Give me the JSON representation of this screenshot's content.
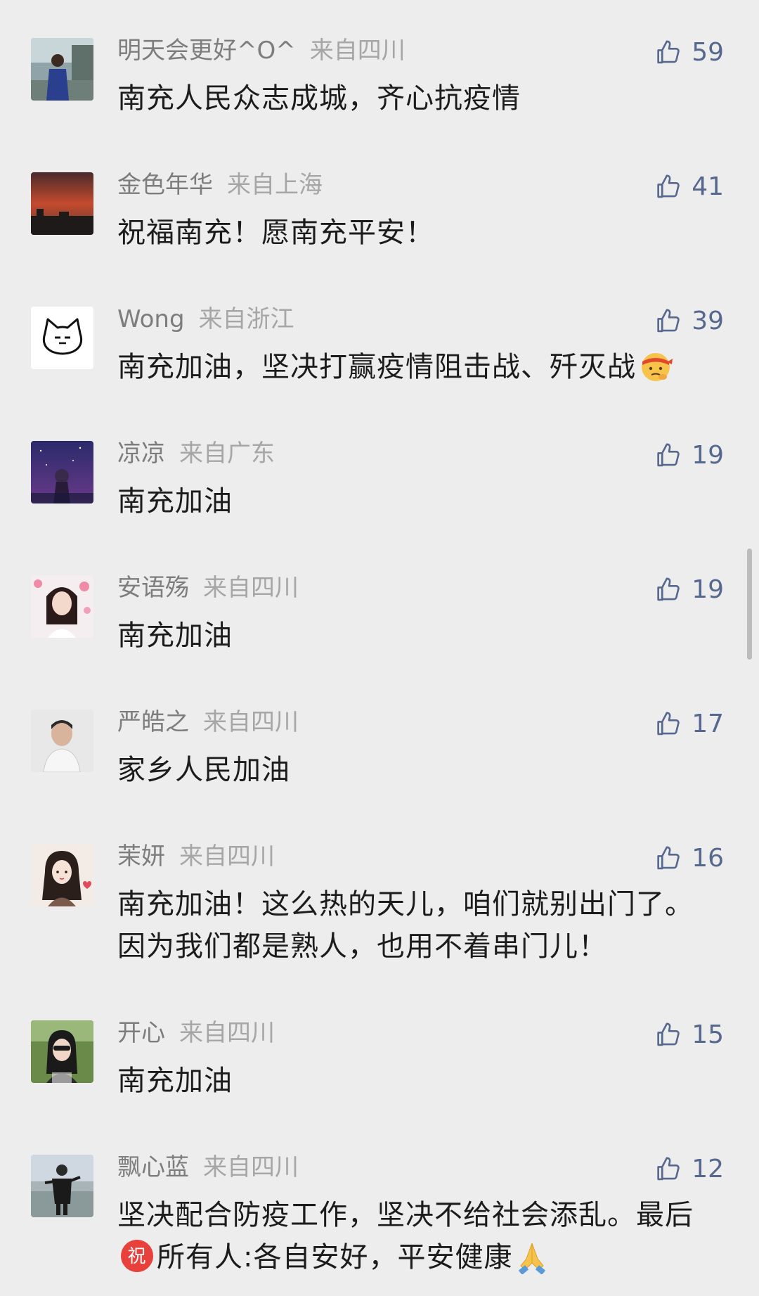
{
  "comments": [
    {
      "user": "明天会更好^O^",
      "location": "来自四川",
      "likes": "59",
      "text": "南充人民众志成城，齐心抗疫情"
    },
    {
      "user": "金色年华",
      "location": "来自上海",
      "likes": "41",
      "text": "祝福南充！愿南充平安！"
    },
    {
      "user": "Wong",
      "location": "来自浙江",
      "likes": "39",
      "text": "南充加油，坚决打赢疫情阻击战、歼灭战"
    },
    {
      "user": "凉凉",
      "location": "来自广东",
      "likes": "19",
      "text": "南充加油"
    },
    {
      "user": "安语殇",
      "location": "来自四川",
      "likes": "19",
      "text": "南充加油"
    },
    {
      "user": "严皓之",
      "location": "来自四川",
      "likes": "17",
      "text": "家乡人民加油"
    },
    {
      "user": "茉妍",
      "location": "来自四川",
      "likes": "16",
      "text": "南充加油！这么热的天儿，咱们就别出门了。因为我们都是熟人，也用不着串门儿！"
    },
    {
      "user": "开心",
      "location": "来自四川",
      "likes": "15",
      "text": "南充加油"
    },
    {
      "user": "飘心蓝",
      "location": "来自四川",
      "likes": "12",
      "text_a": "坚决配合防疫工作，坚决不给社会添乱。最后",
      "emoji_char": "祝",
      "text_b": "所有人:各自安好，平安健康"
    }
  ],
  "colors": {
    "background": "#ededed",
    "username": "#7d7d7d",
    "location": "#a6a6a6",
    "like": "#56688e",
    "text": "#1c1c1c"
  },
  "icons": {
    "like": "thumbs-up-outline-icon",
    "emoji_3": "face-with-headband-emoji",
    "emoji_9a": "red-circle-zhu-emoji",
    "emoji_9b": "folded-hands-emoji"
  }
}
